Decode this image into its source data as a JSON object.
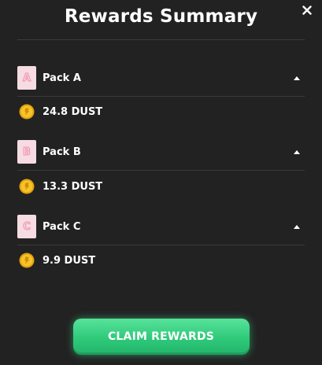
{
  "modal": {
    "title": "Rewards Summary",
    "close_icon": "close-icon"
  },
  "packs": [
    {
      "letter": "A",
      "name": "Pack A",
      "reward": "24.8 DUST",
      "icon": "pack-card-icon",
      "expanded": true
    },
    {
      "letter": "B",
      "name": "Pack B",
      "reward": "13.3 DUST",
      "icon": "pack-card-icon",
      "expanded": true
    },
    {
      "letter": "C",
      "name": "Pack C",
      "reward": "9.9 DUST",
      "icon": "pack-card-icon",
      "expanded": true
    }
  ],
  "coin_icon": "dust-coin-icon",
  "claim_button": {
    "label": "CLAIM REWARDS"
  },
  "colors": {
    "background": "#222222",
    "accent": "#2fc97a",
    "pack_icon": "#f6dbe3",
    "coin": "#f2b51d"
  }
}
